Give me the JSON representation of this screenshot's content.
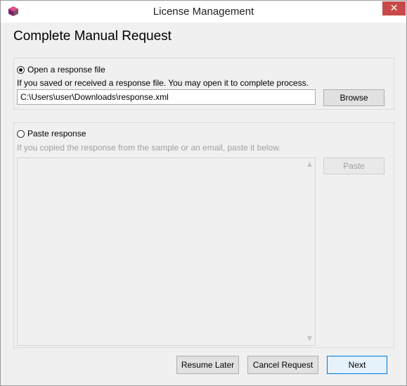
{
  "window": {
    "title": "License Management",
    "close_glyph": "✕",
    "icon": "app-cube-icon"
  },
  "heading": "Complete Manual Request",
  "open_option": {
    "label": "Open a response file",
    "selected": true,
    "description": "If you saved or received a response file. You may open it to complete process.",
    "path_value": "C:\\Users\\user\\Downloads\\response.xml",
    "browse_label": "Browse"
  },
  "paste_option": {
    "label": "Paste response",
    "selected": false,
    "description": "If you copied the response from the sample or an email, paste it below.",
    "paste_label": "Paste",
    "scroll_up_glyph": "▲",
    "scroll_down_glyph": "▼"
  },
  "footer": {
    "resume_label": "Resume Later",
    "cancel_label": "Cancel Request",
    "next_label": "Next"
  },
  "colors": {
    "close_button": "#c74a48",
    "primary_border": "#0078d7",
    "disabled_text": "#a0a0a0",
    "dialog_background": "#f0f0f0"
  }
}
